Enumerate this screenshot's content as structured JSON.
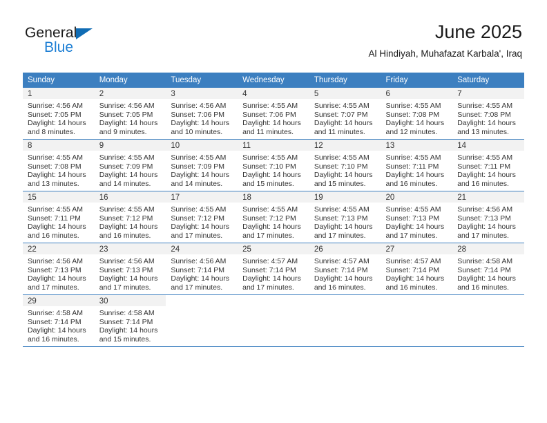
{
  "brand": {
    "name_part1": "General",
    "name_part2": "Blue",
    "logo_icon": "triangle-flag-icon",
    "accent_color": "#1e7fd4",
    "header_color": "#3c7fc0"
  },
  "header": {
    "title": "June 2025",
    "subtitle": "Al Hindiyah, Muhafazat Karbala', Iraq"
  },
  "weekday_headers": [
    "Sunday",
    "Monday",
    "Tuesday",
    "Wednesday",
    "Thursday",
    "Friday",
    "Saturday"
  ],
  "weeks": [
    [
      {
        "day": "1",
        "sunrise": "Sunrise: 4:56 AM",
        "sunset": "Sunset: 7:05 PM",
        "daylight_line1": "Daylight: 14 hours",
        "daylight_line2": "and 8 minutes."
      },
      {
        "day": "2",
        "sunrise": "Sunrise: 4:56 AM",
        "sunset": "Sunset: 7:05 PM",
        "daylight_line1": "Daylight: 14 hours",
        "daylight_line2": "and 9 minutes."
      },
      {
        "day": "3",
        "sunrise": "Sunrise: 4:56 AM",
        "sunset": "Sunset: 7:06 PM",
        "daylight_line1": "Daylight: 14 hours",
        "daylight_line2": "and 10 minutes."
      },
      {
        "day": "4",
        "sunrise": "Sunrise: 4:55 AM",
        "sunset": "Sunset: 7:06 PM",
        "daylight_line1": "Daylight: 14 hours",
        "daylight_line2": "and 11 minutes."
      },
      {
        "day": "5",
        "sunrise": "Sunrise: 4:55 AM",
        "sunset": "Sunset: 7:07 PM",
        "daylight_line1": "Daylight: 14 hours",
        "daylight_line2": "and 11 minutes."
      },
      {
        "day": "6",
        "sunrise": "Sunrise: 4:55 AM",
        "sunset": "Sunset: 7:08 PM",
        "daylight_line1": "Daylight: 14 hours",
        "daylight_line2": "and 12 minutes."
      },
      {
        "day": "7",
        "sunrise": "Sunrise: 4:55 AM",
        "sunset": "Sunset: 7:08 PM",
        "daylight_line1": "Daylight: 14 hours",
        "daylight_line2": "and 13 minutes."
      }
    ],
    [
      {
        "day": "8",
        "sunrise": "Sunrise: 4:55 AM",
        "sunset": "Sunset: 7:08 PM",
        "daylight_line1": "Daylight: 14 hours",
        "daylight_line2": "and 13 minutes."
      },
      {
        "day": "9",
        "sunrise": "Sunrise: 4:55 AM",
        "sunset": "Sunset: 7:09 PM",
        "daylight_line1": "Daylight: 14 hours",
        "daylight_line2": "and 14 minutes."
      },
      {
        "day": "10",
        "sunrise": "Sunrise: 4:55 AM",
        "sunset": "Sunset: 7:09 PM",
        "daylight_line1": "Daylight: 14 hours",
        "daylight_line2": "and 14 minutes."
      },
      {
        "day": "11",
        "sunrise": "Sunrise: 4:55 AM",
        "sunset": "Sunset: 7:10 PM",
        "daylight_line1": "Daylight: 14 hours",
        "daylight_line2": "and 15 minutes."
      },
      {
        "day": "12",
        "sunrise": "Sunrise: 4:55 AM",
        "sunset": "Sunset: 7:10 PM",
        "daylight_line1": "Daylight: 14 hours",
        "daylight_line2": "and 15 minutes."
      },
      {
        "day": "13",
        "sunrise": "Sunrise: 4:55 AM",
        "sunset": "Sunset: 7:11 PM",
        "daylight_line1": "Daylight: 14 hours",
        "daylight_line2": "and 16 minutes."
      },
      {
        "day": "14",
        "sunrise": "Sunrise: 4:55 AM",
        "sunset": "Sunset: 7:11 PM",
        "daylight_line1": "Daylight: 14 hours",
        "daylight_line2": "and 16 minutes."
      }
    ],
    [
      {
        "day": "15",
        "sunrise": "Sunrise: 4:55 AM",
        "sunset": "Sunset: 7:11 PM",
        "daylight_line1": "Daylight: 14 hours",
        "daylight_line2": "and 16 minutes."
      },
      {
        "day": "16",
        "sunrise": "Sunrise: 4:55 AM",
        "sunset": "Sunset: 7:12 PM",
        "daylight_line1": "Daylight: 14 hours",
        "daylight_line2": "and 16 minutes."
      },
      {
        "day": "17",
        "sunrise": "Sunrise: 4:55 AM",
        "sunset": "Sunset: 7:12 PM",
        "daylight_line1": "Daylight: 14 hours",
        "daylight_line2": "and 17 minutes."
      },
      {
        "day": "18",
        "sunrise": "Sunrise: 4:55 AM",
        "sunset": "Sunset: 7:12 PM",
        "daylight_line1": "Daylight: 14 hours",
        "daylight_line2": "and 17 minutes."
      },
      {
        "day": "19",
        "sunrise": "Sunrise: 4:55 AM",
        "sunset": "Sunset: 7:13 PM",
        "daylight_line1": "Daylight: 14 hours",
        "daylight_line2": "and 17 minutes."
      },
      {
        "day": "20",
        "sunrise": "Sunrise: 4:55 AM",
        "sunset": "Sunset: 7:13 PM",
        "daylight_line1": "Daylight: 14 hours",
        "daylight_line2": "and 17 minutes."
      },
      {
        "day": "21",
        "sunrise": "Sunrise: 4:56 AM",
        "sunset": "Sunset: 7:13 PM",
        "daylight_line1": "Daylight: 14 hours",
        "daylight_line2": "and 17 minutes."
      }
    ],
    [
      {
        "day": "22",
        "sunrise": "Sunrise: 4:56 AM",
        "sunset": "Sunset: 7:13 PM",
        "daylight_line1": "Daylight: 14 hours",
        "daylight_line2": "and 17 minutes."
      },
      {
        "day": "23",
        "sunrise": "Sunrise: 4:56 AM",
        "sunset": "Sunset: 7:13 PM",
        "daylight_line1": "Daylight: 14 hours",
        "daylight_line2": "and 17 minutes."
      },
      {
        "day": "24",
        "sunrise": "Sunrise: 4:56 AM",
        "sunset": "Sunset: 7:14 PM",
        "daylight_line1": "Daylight: 14 hours",
        "daylight_line2": "and 17 minutes."
      },
      {
        "day": "25",
        "sunrise": "Sunrise: 4:57 AM",
        "sunset": "Sunset: 7:14 PM",
        "daylight_line1": "Daylight: 14 hours",
        "daylight_line2": "and 17 minutes."
      },
      {
        "day": "26",
        "sunrise": "Sunrise: 4:57 AM",
        "sunset": "Sunset: 7:14 PM",
        "daylight_line1": "Daylight: 14 hours",
        "daylight_line2": "and 16 minutes."
      },
      {
        "day": "27",
        "sunrise": "Sunrise: 4:57 AM",
        "sunset": "Sunset: 7:14 PM",
        "daylight_line1": "Daylight: 14 hours",
        "daylight_line2": "and 16 minutes."
      },
      {
        "day": "28",
        "sunrise": "Sunrise: 4:58 AM",
        "sunset": "Sunset: 7:14 PM",
        "daylight_line1": "Daylight: 14 hours",
        "daylight_line2": "and 16 minutes."
      }
    ],
    [
      {
        "day": "29",
        "sunrise": "Sunrise: 4:58 AM",
        "sunset": "Sunset: 7:14 PM",
        "daylight_line1": "Daylight: 14 hours",
        "daylight_line2": "and 16 minutes."
      },
      {
        "day": "30",
        "sunrise": "Sunrise: 4:58 AM",
        "sunset": "Sunset: 7:14 PM",
        "daylight_line1": "Daylight: 14 hours",
        "daylight_line2": "and 15 minutes."
      },
      {
        "day": "",
        "sunrise": "",
        "sunset": "",
        "daylight_line1": "",
        "daylight_line2": ""
      },
      {
        "day": "",
        "sunrise": "",
        "sunset": "",
        "daylight_line1": "",
        "daylight_line2": ""
      },
      {
        "day": "",
        "sunrise": "",
        "sunset": "",
        "daylight_line1": "",
        "daylight_line2": ""
      },
      {
        "day": "",
        "sunrise": "",
        "sunset": "",
        "daylight_line1": "",
        "daylight_line2": ""
      },
      {
        "day": "",
        "sunrise": "",
        "sunset": "",
        "daylight_line1": "",
        "daylight_line2": ""
      }
    ]
  ]
}
